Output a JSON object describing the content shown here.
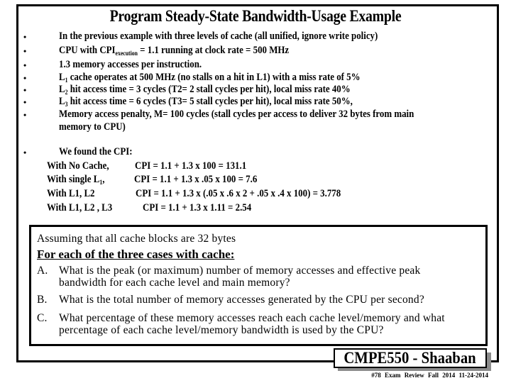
{
  "slide": {
    "title": "Program Steady-State Bandwidth-Usage Example",
    "given": {
      "bullets": [
        {
          "text": "In the previous example with three  levels of cache   (all unified, ignore write policy)"
        },
        {
          "pre": "CPU with CPI",
          "sub": "execution",
          "post": " = 1.1  running at clock rate = 500 MHz"
        },
        {
          "text": "1.3 memory accesses per instruction."
        },
        {
          "pre": "L",
          "sub": "1",
          "post": " cache operates at 500 MHz (no stalls on a hit in L1) with a miss rate of 5%"
        },
        {
          "pre": "L",
          "sub": "2",
          "post": " hit access time = 3 cycles (T2= 2  stall cycles per hit),  local miss rate  40%"
        },
        {
          "pre": "L",
          "sub": "3",
          "post": " hit access time = 6 cycles (T3= 5  stall cycles per hit), local miss rate 50%,"
        },
        {
          "text": "Memory access penalty,  M= 100 cycles  (stall cycles per access to deliver 32 bytes from main",
          "cont": "memory  to CPU)"
        }
      ],
      "bullet_symbol": "•"
    },
    "cpi": {
      "heading": "We found the CPI:",
      "rows": [
        {
          "label": "With No Cache,",
          "formula": "CPI  =  1.1 +  1.3 x 100  =  131.1"
        },
        {
          "label_pre": "With single L",
          "label_sub": "1",
          "label_post": ",",
          "formula": "CPI  =  1.1  +  1.3 x .05 x 100 =  7.6"
        },
        {
          "label": " With L1,  L2",
          "formula": "CPI  =  1.1  +  1.3 x  (.05 x  .6  x 2  +  .05 x  .4  x  100)  = 3.778"
        },
        {
          "label": "With L1,  L2 , L3",
          "formula": "CPI = 1.1 +  1.3 x 1.11  =   2.54"
        }
      ]
    },
    "questions_box": {
      "assumption": "Assuming that all cache blocks are 32 bytes",
      "heading": "For each of the  three cases with cache:",
      "items": [
        {
          "letter": "A.",
          "line1": "What is the peak (or maximum) number of memory accesses and effective peak",
          "line2": "bandwidth for each cache level and main memory?"
        },
        {
          "letter": "B.",
          "line1": "What is the total number of memory accesses generated by the CPU per second?",
          "line2": ""
        },
        {
          "letter": "C.",
          "line1": "What percentage of these memory accesses reach each cache level/memory and what",
          "line2": "percentage of each cache level/memory bandwidth is used by the CPU?"
        }
      ]
    },
    "badge": "CMPE550 - Shaaban",
    "footer": {
      "slide_number": "#78",
      "lecture": "Exam Review",
      "term": "Fall 2014",
      "date": "11-24-2014"
    }
  }
}
